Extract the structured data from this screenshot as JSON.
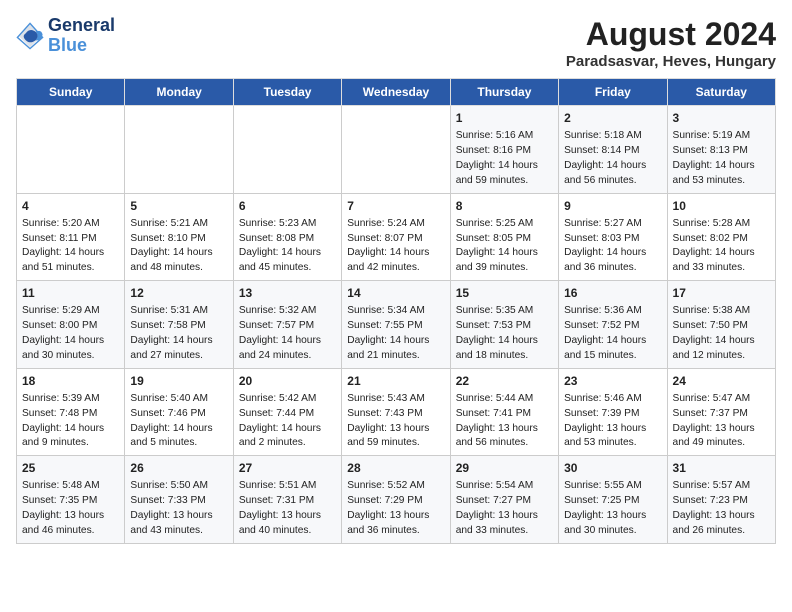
{
  "header": {
    "logo_line1": "General",
    "logo_line2": "Blue",
    "month_year": "August 2024",
    "location": "Paradsasvar, Heves, Hungary"
  },
  "days_of_week": [
    "Sunday",
    "Monday",
    "Tuesday",
    "Wednesday",
    "Thursday",
    "Friday",
    "Saturday"
  ],
  "weeks": [
    [
      {
        "day": "",
        "info": ""
      },
      {
        "day": "",
        "info": ""
      },
      {
        "day": "",
        "info": ""
      },
      {
        "day": "",
        "info": ""
      },
      {
        "day": "1",
        "info": "Sunrise: 5:16 AM\nSunset: 8:16 PM\nDaylight: 14 hours\nand 59 minutes."
      },
      {
        "day": "2",
        "info": "Sunrise: 5:18 AM\nSunset: 8:14 PM\nDaylight: 14 hours\nand 56 minutes."
      },
      {
        "day": "3",
        "info": "Sunrise: 5:19 AM\nSunset: 8:13 PM\nDaylight: 14 hours\nand 53 minutes."
      }
    ],
    [
      {
        "day": "4",
        "info": "Sunrise: 5:20 AM\nSunset: 8:11 PM\nDaylight: 14 hours\nand 51 minutes."
      },
      {
        "day": "5",
        "info": "Sunrise: 5:21 AM\nSunset: 8:10 PM\nDaylight: 14 hours\nand 48 minutes."
      },
      {
        "day": "6",
        "info": "Sunrise: 5:23 AM\nSunset: 8:08 PM\nDaylight: 14 hours\nand 45 minutes."
      },
      {
        "day": "7",
        "info": "Sunrise: 5:24 AM\nSunset: 8:07 PM\nDaylight: 14 hours\nand 42 minutes."
      },
      {
        "day": "8",
        "info": "Sunrise: 5:25 AM\nSunset: 8:05 PM\nDaylight: 14 hours\nand 39 minutes."
      },
      {
        "day": "9",
        "info": "Sunrise: 5:27 AM\nSunset: 8:03 PM\nDaylight: 14 hours\nand 36 minutes."
      },
      {
        "day": "10",
        "info": "Sunrise: 5:28 AM\nSunset: 8:02 PM\nDaylight: 14 hours\nand 33 minutes."
      }
    ],
    [
      {
        "day": "11",
        "info": "Sunrise: 5:29 AM\nSunset: 8:00 PM\nDaylight: 14 hours\nand 30 minutes."
      },
      {
        "day": "12",
        "info": "Sunrise: 5:31 AM\nSunset: 7:58 PM\nDaylight: 14 hours\nand 27 minutes."
      },
      {
        "day": "13",
        "info": "Sunrise: 5:32 AM\nSunset: 7:57 PM\nDaylight: 14 hours\nand 24 minutes."
      },
      {
        "day": "14",
        "info": "Sunrise: 5:34 AM\nSunset: 7:55 PM\nDaylight: 14 hours\nand 21 minutes."
      },
      {
        "day": "15",
        "info": "Sunrise: 5:35 AM\nSunset: 7:53 PM\nDaylight: 14 hours\nand 18 minutes."
      },
      {
        "day": "16",
        "info": "Sunrise: 5:36 AM\nSunset: 7:52 PM\nDaylight: 14 hours\nand 15 minutes."
      },
      {
        "day": "17",
        "info": "Sunrise: 5:38 AM\nSunset: 7:50 PM\nDaylight: 14 hours\nand 12 minutes."
      }
    ],
    [
      {
        "day": "18",
        "info": "Sunrise: 5:39 AM\nSunset: 7:48 PM\nDaylight: 14 hours\nand 9 minutes."
      },
      {
        "day": "19",
        "info": "Sunrise: 5:40 AM\nSunset: 7:46 PM\nDaylight: 14 hours\nand 5 minutes."
      },
      {
        "day": "20",
        "info": "Sunrise: 5:42 AM\nSunset: 7:44 PM\nDaylight: 14 hours\nand 2 minutes."
      },
      {
        "day": "21",
        "info": "Sunrise: 5:43 AM\nSunset: 7:43 PM\nDaylight: 13 hours\nand 59 minutes."
      },
      {
        "day": "22",
        "info": "Sunrise: 5:44 AM\nSunset: 7:41 PM\nDaylight: 13 hours\nand 56 minutes."
      },
      {
        "day": "23",
        "info": "Sunrise: 5:46 AM\nSunset: 7:39 PM\nDaylight: 13 hours\nand 53 minutes."
      },
      {
        "day": "24",
        "info": "Sunrise: 5:47 AM\nSunset: 7:37 PM\nDaylight: 13 hours\nand 49 minutes."
      }
    ],
    [
      {
        "day": "25",
        "info": "Sunrise: 5:48 AM\nSunset: 7:35 PM\nDaylight: 13 hours\nand 46 minutes."
      },
      {
        "day": "26",
        "info": "Sunrise: 5:50 AM\nSunset: 7:33 PM\nDaylight: 13 hours\nand 43 minutes."
      },
      {
        "day": "27",
        "info": "Sunrise: 5:51 AM\nSunset: 7:31 PM\nDaylight: 13 hours\nand 40 minutes."
      },
      {
        "day": "28",
        "info": "Sunrise: 5:52 AM\nSunset: 7:29 PM\nDaylight: 13 hours\nand 36 minutes."
      },
      {
        "day": "29",
        "info": "Sunrise: 5:54 AM\nSunset: 7:27 PM\nDaylight: 13 hours\nand 33 minutes."
      },
      {
        "day": "30",
        "info": "Sunrise: 5:55 AM\nSunset: 7:25 PM\nDaylight: 13 hours\nand 30 minutes."
      },
      {
        "day": "31",
        "info": "Sunrise: 5:57 AM\nSunset: 7:23 PM\nDaylight: 13 hours\nand 26 minutes."
      }
    ]
  ]
}
